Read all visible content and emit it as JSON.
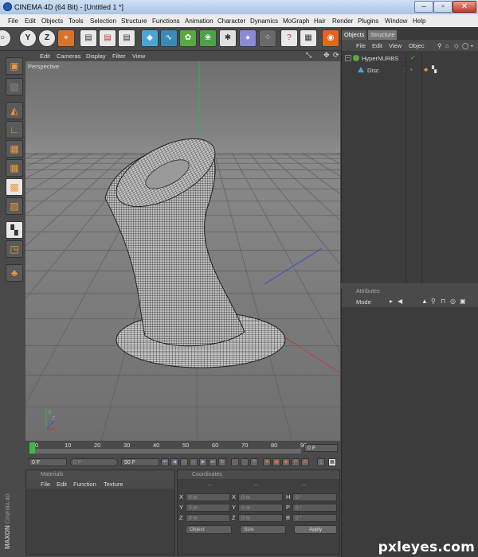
{
  "window": {
    "title": "CINEMA 4D (64 Bit) - [Untitled 1 *]"
  },
  "menubar": [
    "File",
    "Edit",
    "Objects",
    "Tools",
    "Selection",
    "Structure",
    "Functions",
    "Animation",
    "Character",
    "Dynamics",
    "MoGraph",
    "Hair",
    "Render",
    "Plugins",
    "Window",
    "Help"
  ],
  "toolbar": {
    "axis_y": "Y",
    "axis_z": "Z"
  },
  "viewport": {
    "menu": [
      "Edit",
      "Cameras",
      "Display",
      "Filter",
      "View"
    ],
    "label": "Perspective",
    "axis_y": "Y",
    "axis_z": "Z"
  },
  "timeline": {
    "ticks": [
      "0",
      "10",
      "20",
      "30",
      "40",
      "50",
      "60",
      "70",
      "80",
      "90"
    ],
    "current_frame": "0 F",
    "start_frame": "0 F",
    "preview_start": "0 F",
    "end_frame": "90 F"
  },
  "materials": {
    "title": "Materials",
    "menu": [
      "File",
      "Edit",
      "Function",
      "Texture"
    ]
  },
  "coordinates": {
    "title": "Coordinates",
    "col_heads": [
      "--",
      "--",
      "--"
    ],
    "rows": [
      {
        "a": "X",
        "av": "0 m",
        "b": "X",
        "bv": "0 m",
        "c": "H",
        "cv": "0 °"
      },
      {
        "a": "Y",
        "av": "0 m",
        "b": "Y",
        "bv": "0 m",
        "c": "P",
        "cv": "0 °"
      },
      {
        "a": "Z",
        "av": "0 m",
        "b": "Z",
        "bv": "0 m",
        "c": "B",
        "cv": "0 °"
      }
    ],
    "mode_select": "Object",
    "size_select": "Size",
    "apply": "Apply"
  },
  "objects": {
    "tabs": [
      "Objects",
      "Structure"
    ],
    "menu": [
      "File",
      "Edit",
      "View",
      "Objec"
    ],
    "items": [
      {
        "name": "HyperNURBS"
      },
      {
        "name": "Disc"
      }
    ]
  },
  "attributes": {
    "title": "Attributes",
    "mode": "Mode"
  },
  "brand": {
    "maxon": "MAXON",
    "product": "CINEMA 4D"
  },
  "watermark": "pxleyes.com"
}
